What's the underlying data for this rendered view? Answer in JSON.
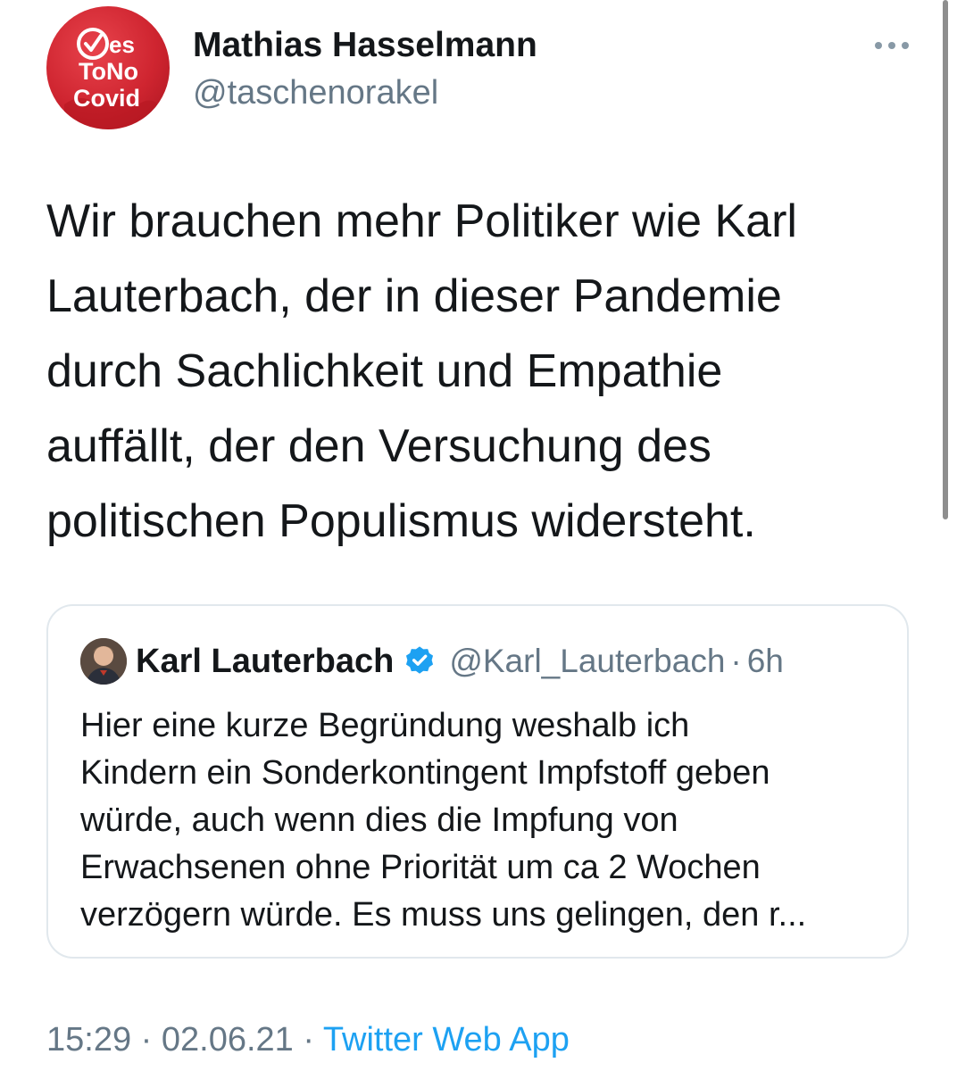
{
  "author": {
    "name": "Mathias Hasselmann",
    "handle": "@taschenorakel",
    "avatar_text": [
      "es",
      "ToNo",
      "Covid"
    ]
  },
  "more_icon": "ellipsis-icon",
  "tweet": {
    "lines": [
      "Wir brauchen mehr Politiker wie Karl",
      "Lauterbach, der in dieser Pandemie",
      "durch Sachlichkeit und Empathie",
      "auffällt, der den Versuchung des",
      "politischen Populismus widersteht."
    ]
  },
  "quoted": {
    "name": "Karl Lauterbach",
    "verified_icon": "verified-badge-icon",
    "handle": "@Karl_Lauterbach",
    "separator": "·",
    "time": "6h",
    "lines": [
      "Hier eine kurze Begründung weshalb ich",
      "Kindern ein Sonderkontingent Impfstoff geben",
      "würde, auch wenn dies die Impfung von",
      "Erwachsenen ohne Priorität um ca 2 Wochen",
      "verzögern würde. Es muss uns gelingen, den r..."
    ]
  },
  "meta": {
    "time": "15:29",
    "separator": " · ",
    "date": "02.06.21",
    "source": "Twitter Web App"
  },
  "colors": {
    "text": "#14171a",
    "secondary": "#657786",
    "link": "#1da1f2",
    "border": "#e1e8ed",
    "avatar_red": "#cf2530"
  }
}
